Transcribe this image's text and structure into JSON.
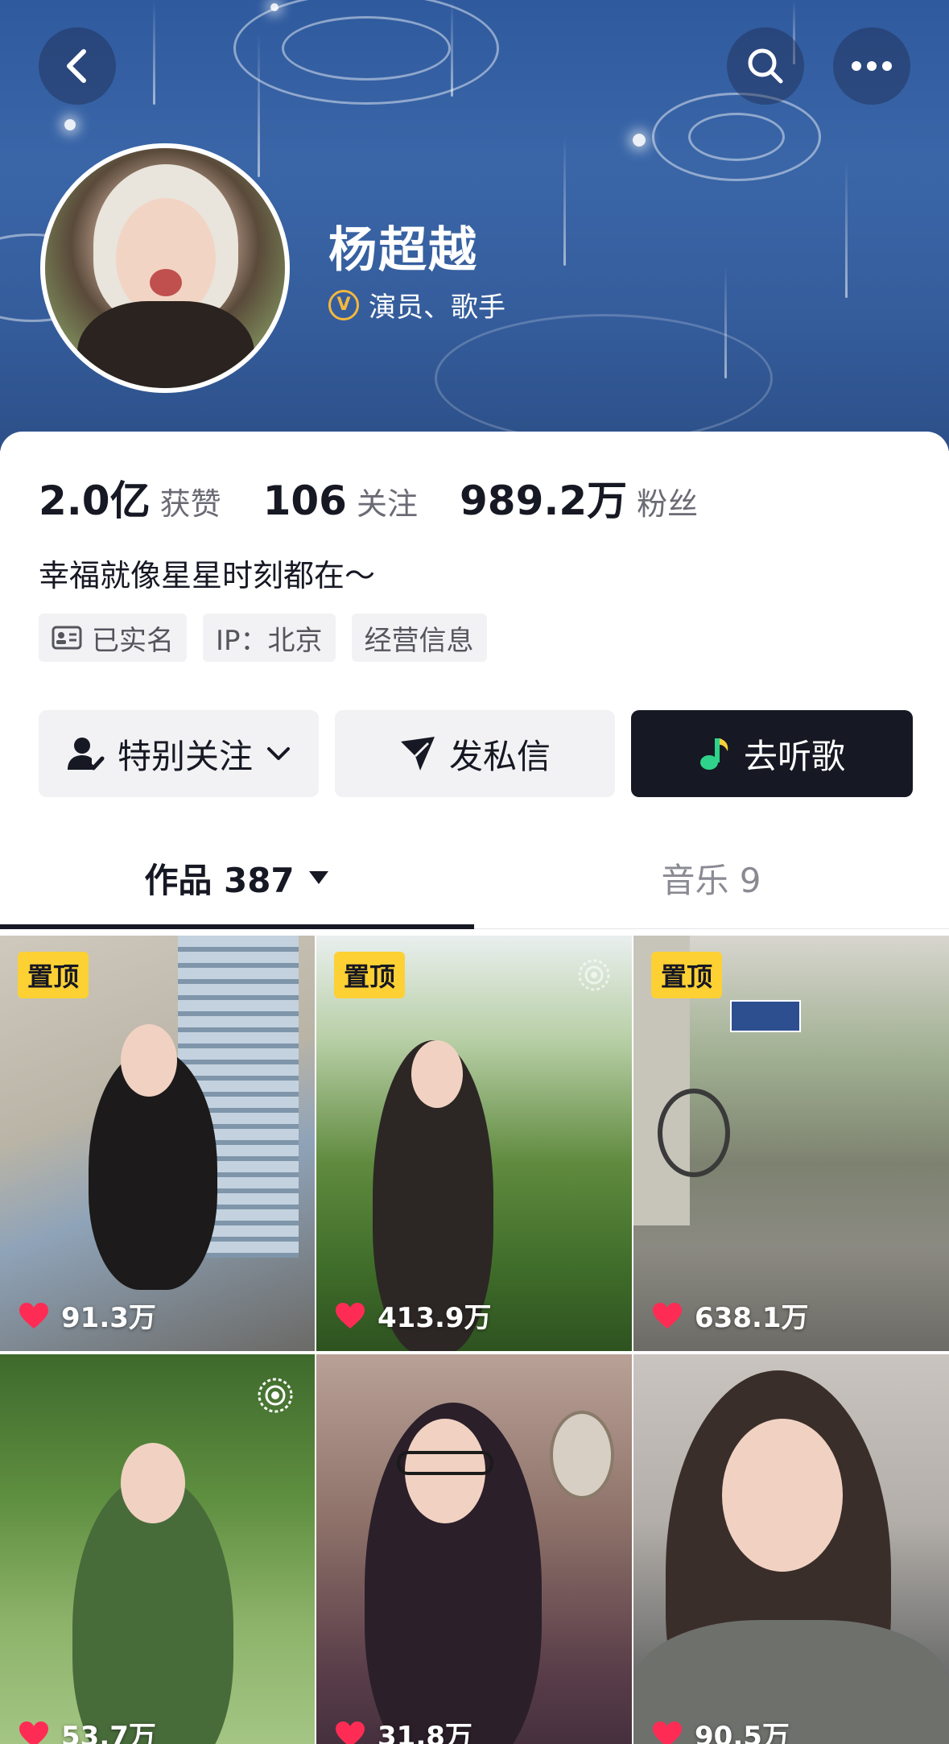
{
  "header": {
    "name": "杨超越",
    "verified_badge": "V",
    "verified_text": "演员、歌手",
    "icons": [
      "back-icon",
      "search-icon",
      "more-icon"
    ]
  },
  "stats": [
    {
      "value": "2.0亿",
      "label": "获赞"
    },
    {
      "value": "106",
      "label": "关注"
    },
    {
      "value": "989.2万",
      "label": "粉丝"
    }
  ],
  "bio": "幸福就像星星时刻都在～",
  "tags": [
    {
      "icon": "id-card-icon",
      "label": "已实名"
    },
    {
      "label": "IP：北京"
    },
    {
      "label": "经营信息"
    }
  ],
  "actions": {
    "follow_label": "特别关注",
    "message_label": "发私信",
    "music_label": "去听歌"
  },
  "tabs": [
    {
      "label": "作品 387"
    },
    {
      "label": "音乐 9"
    }
  ],
  "videos": [
    {
      "pinned": "置顶",
      "likes": "91.3万"
    },
    {
      "pinned": "置顶",
      "likes": "413.9万"
    },
    {
      "pinned": "置顶",
      "likes": "638.1万"
    },
    {
      "likes": "53.7万"
    },
    {
      "likes": "31.8万"
    },
    {
      "likes": "90.5万"
    }
  ],
  "colors": {
    "header_bg": "#3a66a8",
    "pinned_badge": "#fdd034",
    "like_heart": "#fe2c55",
    "dark_button": "#161823"
  }
}
